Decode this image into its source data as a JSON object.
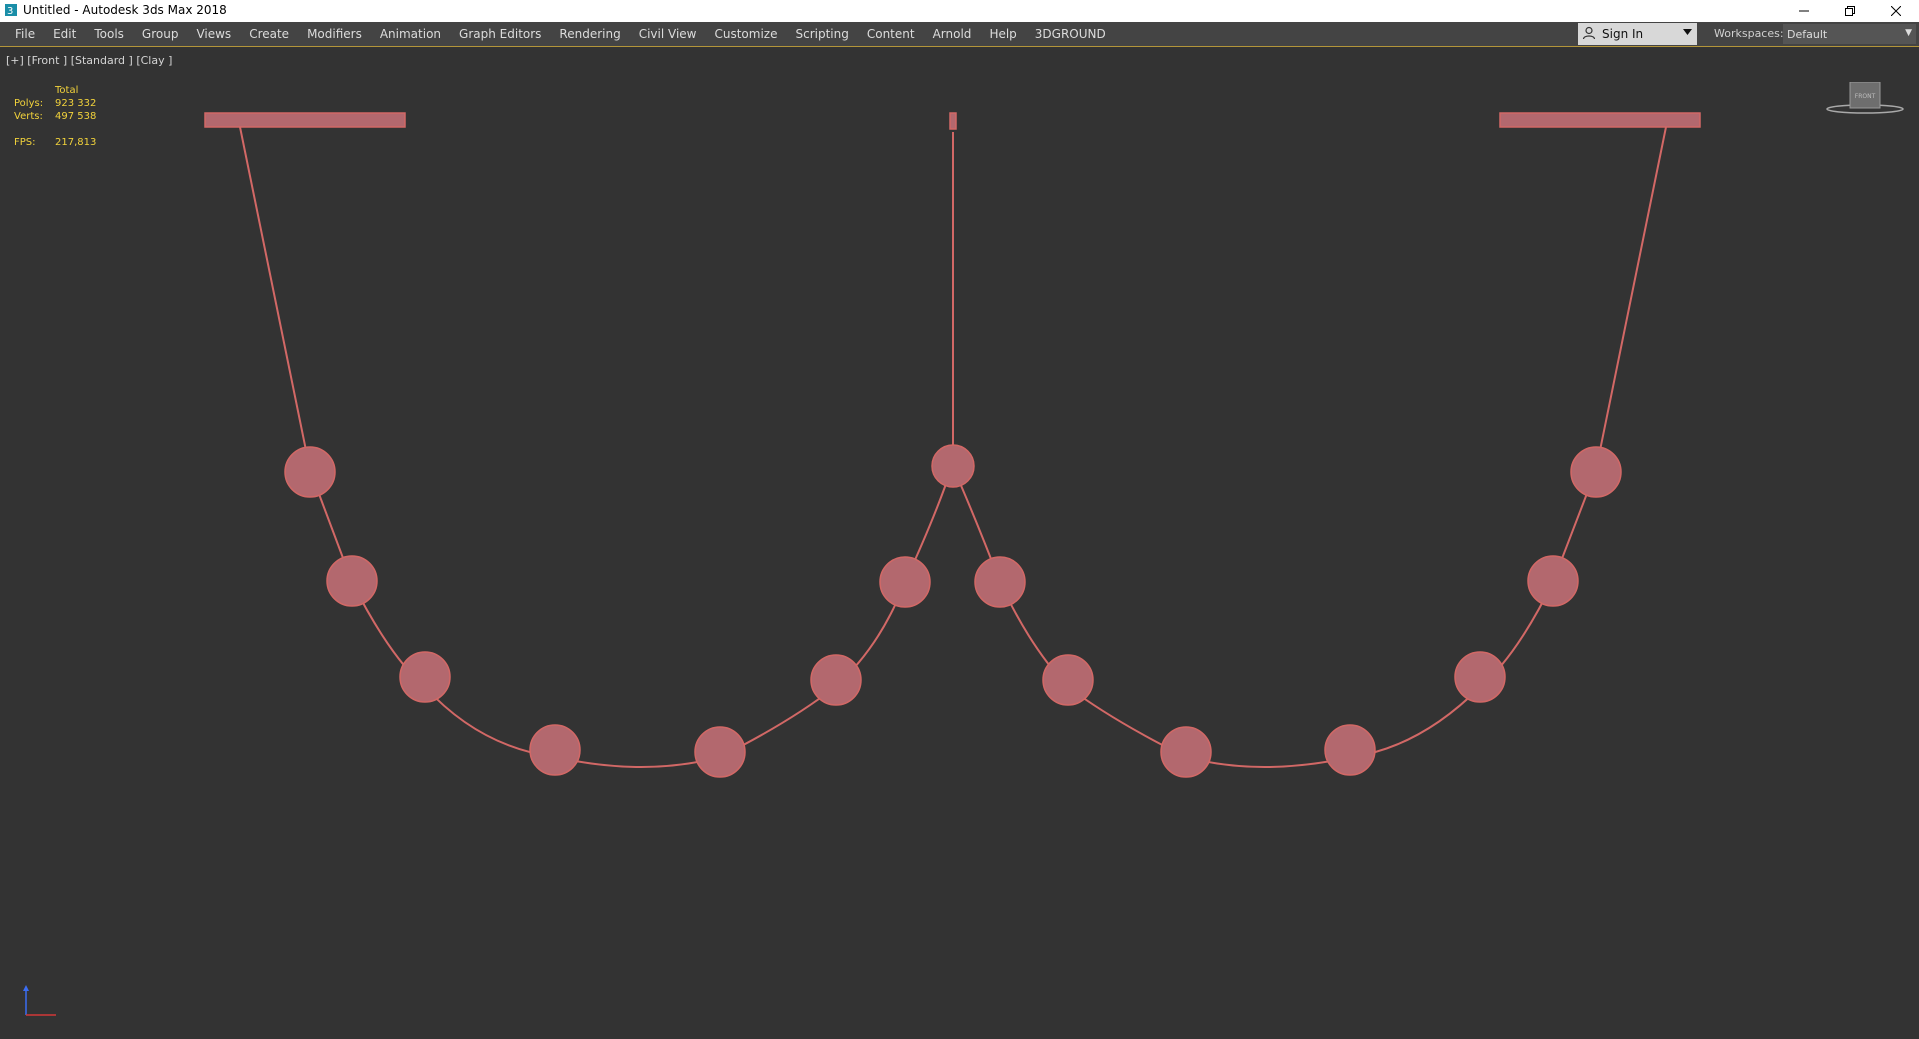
{
  "window": {
    "title": "Untitled - Autodesk 3ds Max 2018"
  },
  "menu": {
    "items": [
      "File",
      "Edit",
      "Tools",
      "Group",
      "Views",
      "Create",
      "Modifiers",
      "Animation",
      "Graph Editors",
      "Rendering",
      "Civil View",
      "Customize",
      "Scripting",
      "Content",
      "Arnold",
      "Help",
      "3DGROUND"
    ]
  },
  "signin": {
    "label": "Sign In"
  },
  "workspaces": {
    "label": "Workspaces:",
    "value": "Default"
  },
  "viewport": {
    "label": "[+] [Front ] [Standard ] [Clay ]",
    "stats": {
      "header": "Total",
      "polys_label": "Polys:",
      "polys_value": "923 332",
      "verts_label": "Verts:",
      "verts_value": "497 538",
      "fps_label": "FPS:",
      "fps_value": "217,813"
    },
    "viewcube_label": "FRONT"
  },
  "colors": {
    "object_fill": "#b3686e",
    "object_line": "#d26866",
    "stats_text": "#f1d23b",
    "viewport_bg": "#333333"
  },
  "icons": [
    "app-icon",
    "minimize-icon",
    "restore-icon",
    "close-icon",
    "user-icon",
    "chevron-down-icon",
    "viewcube-icon",
    "axis-gizmo-icon"
  ]
}
